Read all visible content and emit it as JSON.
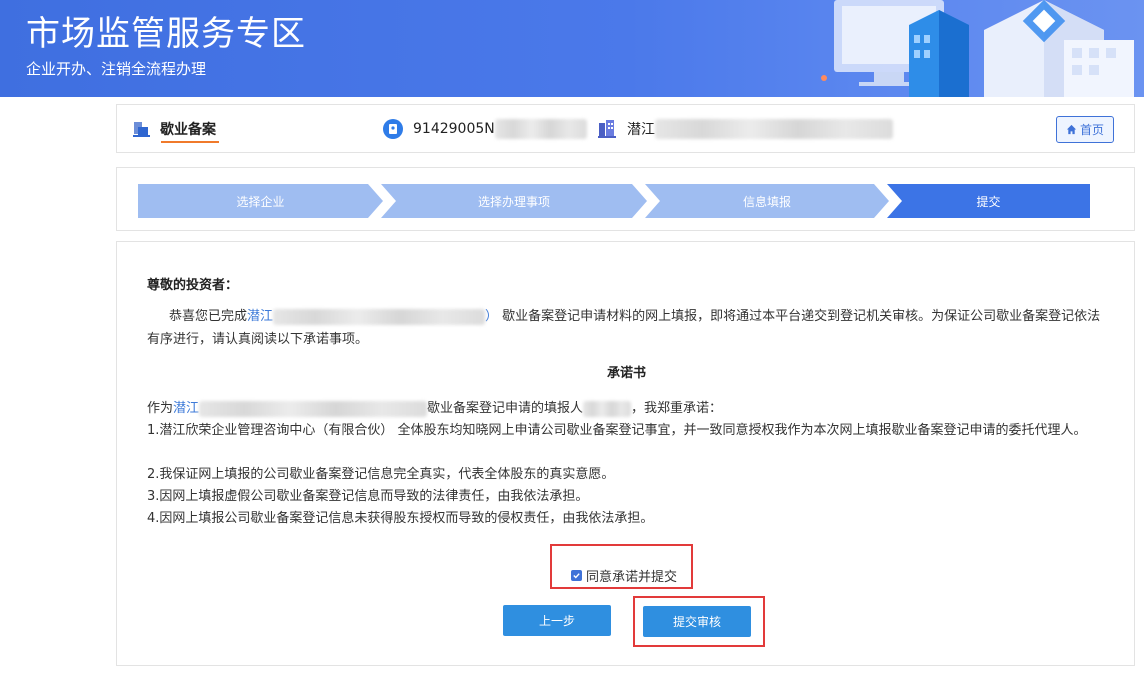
{
  "banner": {
    "title": "市场监管服务专区",
    "subtitle": "企业开办、注销全流程办理"
  },
  "infobar": {
    "tab_label": "歇业备案",
    "credit_code": "91429005N",
    "company_prefix": "潜江",
    "home_label": "首页"
  },
  "steps": [
    {
      "label": "选择企业",
      "state": "done"
    },
    {
      "label": "选择办理事项",
      "state": "done"
    },
    {
      "label": "信息填报",
      "state": "done"
    },
    {
      "label": "提交",
      "state": "active"
    }
  ],
  "content": {
    "greeting": "尊敬的投资者：",
    "para1_start": "恭喜您已完成",
    "para1_company": "潜江",
    "para1_paren": "）",
    "para1_rest": " 歇业备案登记申请材料的网上填报，即将通过本平台递交到登记机关审核。为保证公司歇业备案登记依法有序进行，请认真阅读以下承诺事项。",
    "doc_title": "承诺书",
    "pledge_as": "作为",
    "pledge_company": "潜江",
    "pledge_mid": "歇业备案登记申请的填报人",
    "pledge_end": "，我郑重承诺：",
    "items": [
      "1.潜江欣荣企业管理咨询中心（有限合伙） 全体股东均知晓网上申请公司歇业备案登记事宜，并一致同意授权我作为本次网上填报歇业备案登记申请的委托代理人。",
      "2.我保证网上填报的公司歇业备案登记信息完全真实，代表全体股东的真实意愿。",
      "3.因网上填报虚假公司歇业备案登记信息而导致的法律责任，由我依法承担。",
      "4.因网上填报公司歇业备案登记信息未获得股东授权而导致的侵权责任，由我依法承担。"
    ],
    "agree_label": "同意承诺并提交",
    "agree_checked": true,
    "prev_label": "上一步",
    "submit_label": "提交审核"
  },
  "colors": {
    "banner": "#4b79ea",
    "step_done": "#9fbdf1",
    "step_active": "#3c74e6",
    "button": "#2f8fe0",
    "highlight_border": "#e23a3a",
    "link": "#3d7ad8"
  }
}
